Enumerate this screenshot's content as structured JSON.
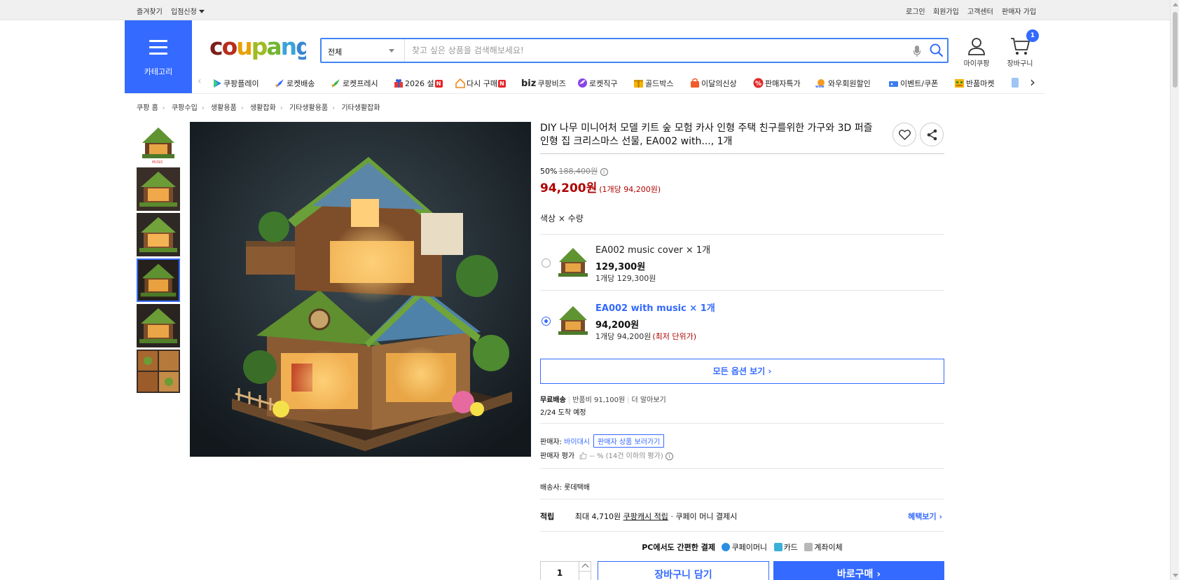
{
  "topbar": {
    "favorites": "즐겨찾기",
    "vendor_signup": "입점신청",
    "login": "로그인",
    "join": "회원가입",
    "customer_center": "고객센터",
    "seller_join": "판매자 가입"
  },
  "header": {
    "category_label": "카테고리",
    "logo_text": "coupang",
    "search_category": "전체",
    "search_placeholder": "찾고 싶은 상품을 검색해보세요!",
    "my_coupang": "마이쿠팡",
    "cart": "장바구니",
    "cart_count": "1"
  },
  "service_nav": [
    {
      "label": "쿠팡플레이",
      "icon": "play-icon"
    },
    {
      "label": "로켓배송",
      "icon": "rocket-icon"
    },
    {
      "label": "로켓프레시",
      "icon": "rocket-fresh-icon"
    },
    {
      "label": "2026 설",
      "icon": "gift-icon",
      "badge": "N"
    },
    {
      "label": "다시 구매",
      "icon": "house-icon",
      "badge": "N"
    },
    {
      "label": "쿠팡비즈",
      "icon": "biz-icon",
      "prefix": "biz"
    },
    {
      "label": "로켓직구",
      "icon": "globe-icon"
    },
    {
      "label": "골드박스",
      "icon": "goldbox-icon"
    },
    {
      "label": "이달의신상",
      "icon": "new-bag-icon"
    },
    {
      "label": "판매자특가",
      "icon": "percent-icon"
    },
    {
      "label": "와우회원할인",
      "icon": "wow-icon"
    },
    {
      "label": "이벤트/쿠폰",
      "icon": "coupon-icon"
    },
    {
      "label": "반품마켓",
      "icon": "market-icon"
    }
  ],
  "breadcrumb": [
    "쿠팡 홈",
    "쿠팡수입",
    "생활용품",
    "생활잡화",
    "기타생활용품",
    "기타생활잡화"
  ],
  "product": {
    "title": "DIY 나무 미니어처 모델 키트 숲 모험 카사 인형 주택 친구를위한 가구와 3D 퍼즐 인형 집 크리스마스 선물, EA002 with..., 1개",
    "discount_rate": "50%",
    "original_price": "188,400원",
    "price": "94,200원",
    "unit_price": "(1개당 94,200원)",
    "option_header": "색상 × 수량",
    "options": [
      {
        "name": "EA002 music cover × 1개",
        "price": "129,300원",
        "unit": "1개당 129,300원",
        "note": "",
        "selected": false
      },
      {
        "name": "EA002 with music × 1개",
        "price": "94,200원",
        "unit": "1개당 94,200원",
        "note": "(최저 단위가)",
        "selected": true
      }
    ],
    "all_options": "모든 옵션 보기",
    "shipping": {
      "free": "무료배송",
      "return_fee": "반품비 91,100원",
      "learn_more": "더 알아보기",
      "arrival": "2/24 도착 예정"
    },
    "seller": {
      "label": "판매자:",
      "name": "바이대시",
      "link": "판매자 상품 보러가기",
      "rating_label": "판매자 평가",
      "rating_value": "-- % (14건 이하의 평가)"
    },
    "courier": "배송사:  롯데택배",
    "reward": {
      "head": "적립",
      "text_pre": "최대 4,710원",
      "text_link": "쿠팡캐시 적립",
      "text_post": "· 쿠페이 머니 결제시",
      "more": "혜택보기"
    },
    "pay": {
      "lead": "PC에서도 간편한 결제",
      "m1": "쿠페이머니",
      "m2": "카드",
      "m3": "계좌이체"
    },
    "quantity": "1",
    "add_cart": "장바구니 담기",
    "buy_now": "바로구매"
  },
  "colors": {
    "accent": "#346aff",
    "price_red": "#ae0000"
  }
}
